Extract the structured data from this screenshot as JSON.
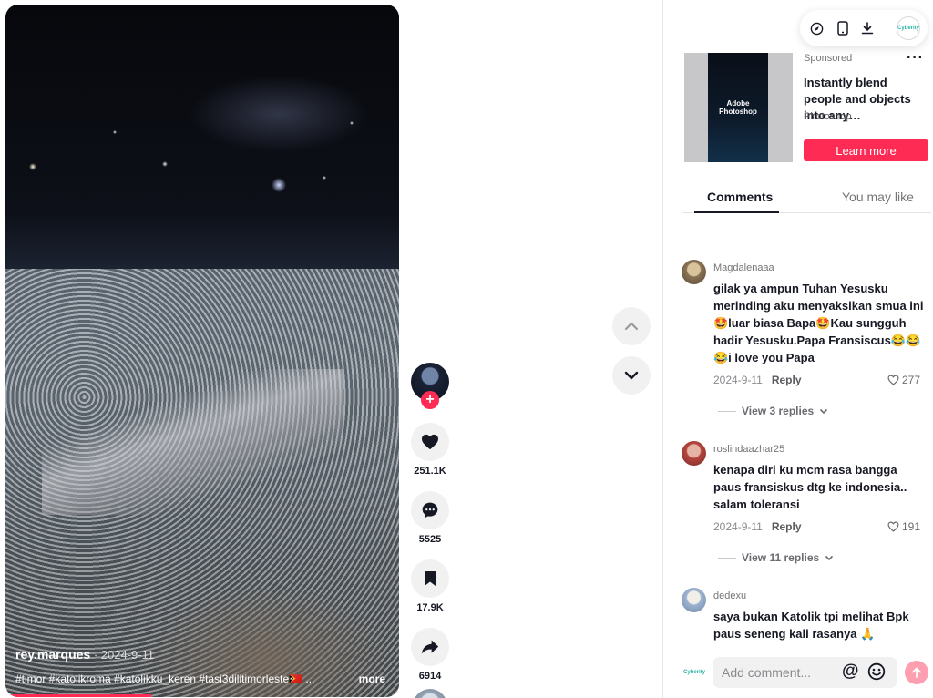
{
  "video": {
    "author": "rey.marques",
    "date": " · 2024-9-11",
    "caption": "#timor #katolikroma #katolikku_keren #tasi3dilitimorleste🇹🇱 ...",
    "more_label": "more",
    "progress_fraction": 0.37
  },
  "actions": {
    "likes": "251.1K",
    "comments": "5525",
    "saves": "17.9K",
    "shares": "6914",
    "follow_label": "+"
  },
  "ad": {
    "sponsored_label": "Sponsored",
    "more_label": "···",
    "thumbnail_text": "Adobe Photoshop",
    "title": "Instantly blend people and objects into any…",
    "brand": "Photoshop",
    "cta_label": "Learn more"
  },
  "topbar": {
    "logo_text": "Cyberity"
  },
  "tabs": {
    "comments": "Comments",
    "you_may_like": "You may like"
  },
  "comments": [
    {
      "user": "Magdalenaaa",
      "text": "gilak ya ampun Tuhan Yesusku merinding aku menyaksikan smua ini 🤩luar biasa Bapa🤩Kau sungguh hadir Yesusku.Papa Fransiscus😂😂😂i love you Papa",
      "date": "2024-9-11",
      "reply_label": "Reply",
      "likes": "277",
      "view_replies": "View 3 replies"
    },
    {
      "user": "roslindaazhar25",
      "text": "kenapa diri ku mcm rasa bangga paus fransiskus dtg ke indonesia.. salam toleransi",
      "date": "2024-9-11",
      "reply_label": "Reply",
      "likes": "191",
      "view_replies": "View 11 replies"
    },
    {
      "user": "dedexu",
      "text": "saya bukan Katolik tpi melihat Bpk paus seneng kali rasanya 🙏"
    }
  ],
  "composer": {
    "placeholder": "Add comment...",
    "at_label": "@",
    "logo_text": "Cyberity"
  },
  "colors": {
    "accent": "#fe2c55",
    "text": "#161823",
    "muted": "#757575"
  }
}
